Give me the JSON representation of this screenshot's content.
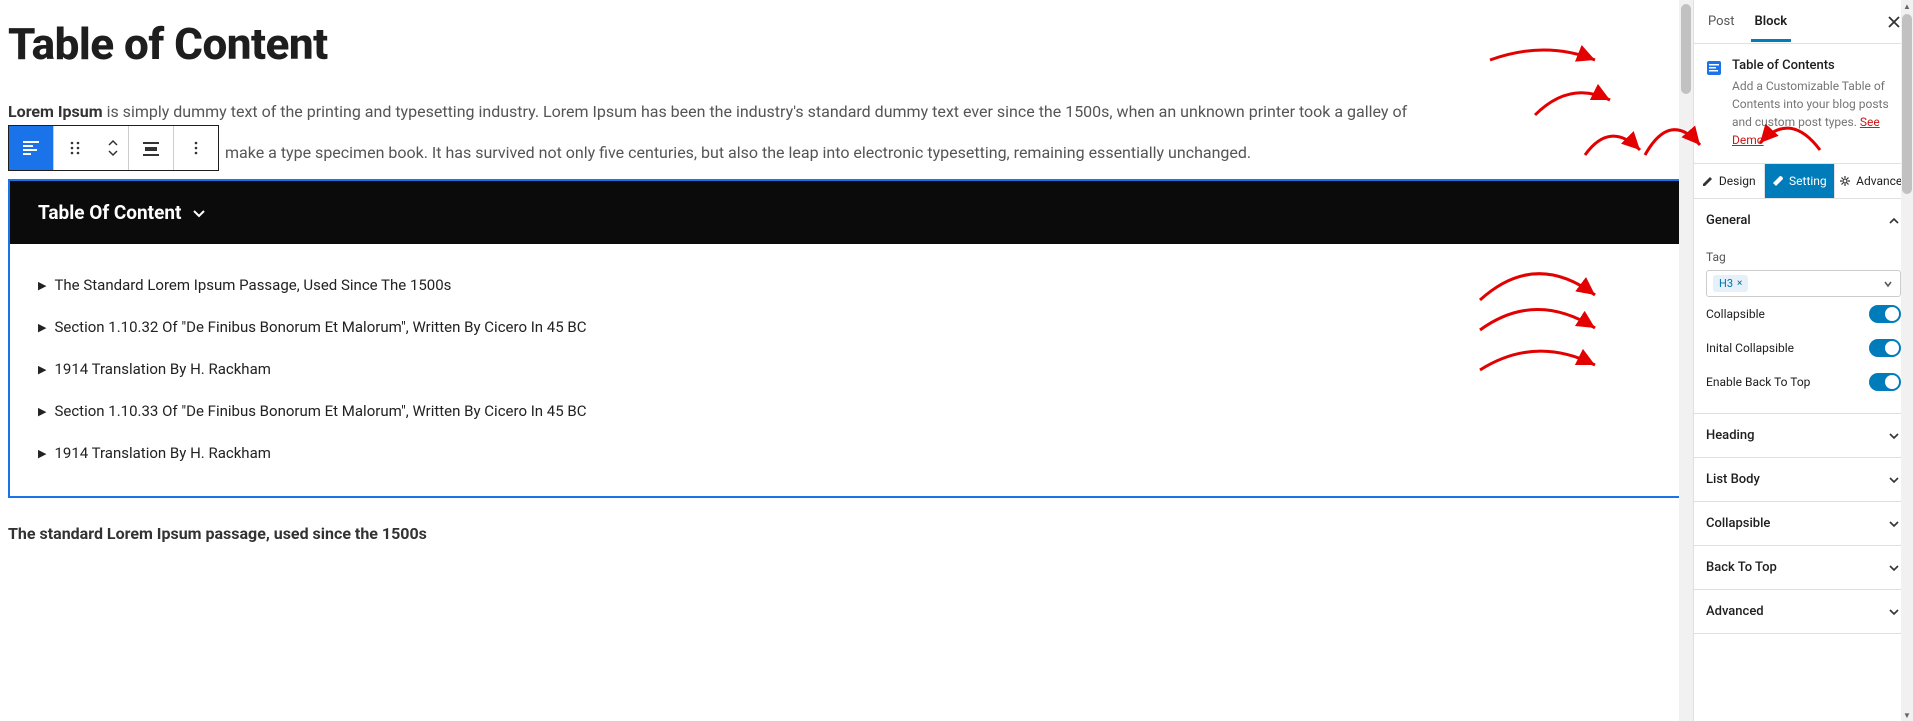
{
  "page": {
    "title": "Table of Content",
    "intro_bold": "Lorem Ipsum",
    "intro_text_1": " is simply dummy text of the printing and typesetting industry. Lorem Ipsum has been the industry's standard dummy text ever since the 1500s, when an unknown printer took a galley of ",
    "intro_text_2": "make a type specimen book. It has survived not only five centuries, but also the leap into electronic typesetting, remaining essentially unchanged.",
    "sub_heading": "The standard Lorem Ipsum passage, used since the 1500s"
  },
  "toc": {
    "header": "Table Of Content",
    "items": [
      "The Standard Lorem Ipsum Passage, Used Since The 1500s",
      "Section 1.10.32 Of \"De Finibus Bonorum Et Malorum\", Written By Cicero In 45 BC",
      "1914 Translation By H. Rackham",
      "Section 1.10.33 Of \"De Finibus Bonorum Et Malorum\", Written By Cicero In 45 BC",
      "1914 Translation By H. Rackham"
    ]
  },
  "sidebar": {
    "tabs": {
      "post": "Post",
      "block": "Block"
    },
    "block": {
      "name": "Table of Contents",
      "desc": "Add a Customizable Table of Contents into your blog posts and custom post types.  ",
      "see_demo": "See Demo"
    },
    "modes": {
      "design": "Design",
      "setting": "Setting",
      "advanced": "Advanced"
    },
    "general": {
      "label": "General",
      "tag_label": "Tag",
      "tag_value": "H3",
      "collapsible": "Collapsible",
      "initial_collapsible": "Inital Collapsible",
      "back_to_top": "Enable Back To Top"
    },
    "sections": {
      "heading": "Heading",
      "list_body": "List Body",
      "collapsible": "Collapsible",
      "back_to_top": "Back To Top",
      "advanced": "Advanced"
    }
  }
}
